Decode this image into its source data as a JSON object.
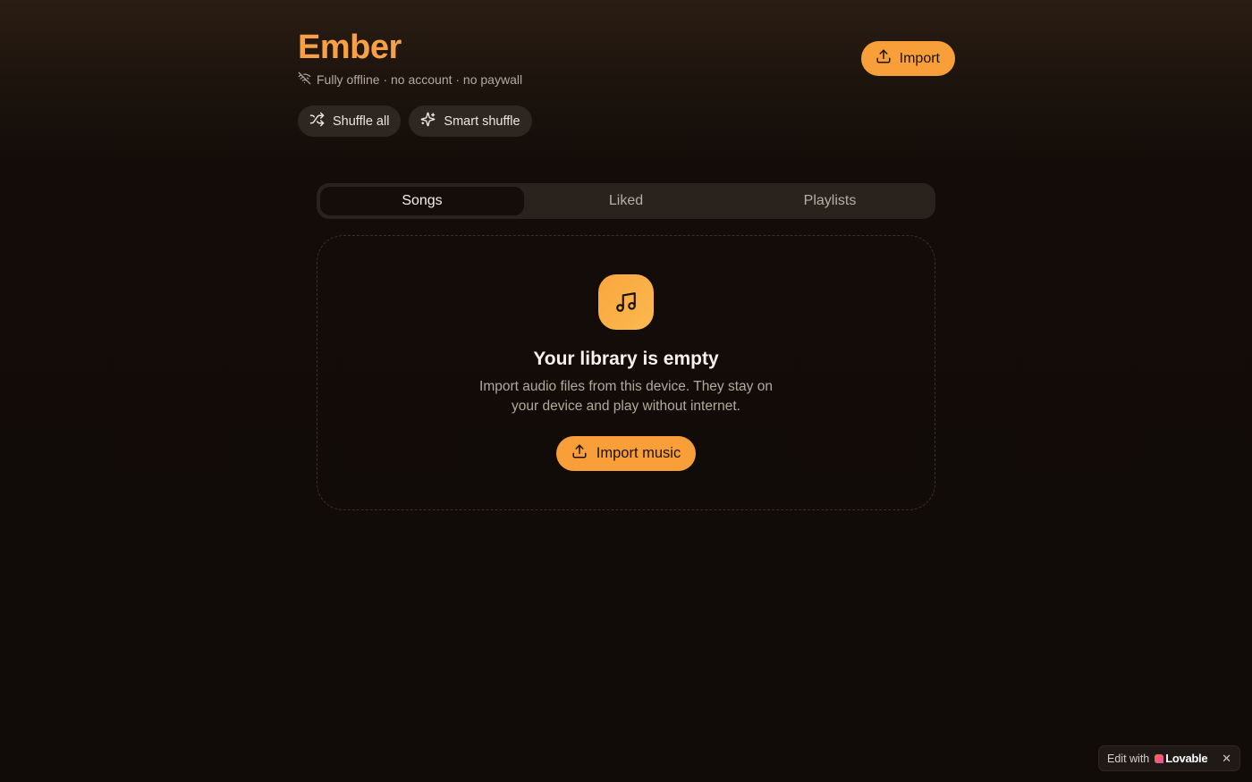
{
  "header": {
    "title": "Ember",
    "subtitle": "Fully offline · no account · no paywall",
    "subtitle_icon": "wifi-off-icon",
    "import_label": "Import",
    "import_icon": "upload-icon"
  },
  "actions": [
    {
      "label": "Shuffle all",
      "icon": "shuffle-icon"
    },
    {
      "label": "Smart shuffle",
      "icon": "sparkles-icon"
    }
  ],
  "tabs": [
    {
      "label": "Songs",
      "active": true
    },
    {
      "label": "Liked",
      "active": false
    },
    {
      "label": "Playlists",
      "active": false
    }
  ],
  "empty_state": {
    "icon": "music-note-icon",
    "title": "Your library is empty",
    "description": "Import audio files from this device. They stay on your device and play without internet.",
    "button_label": "Import music",
    "button_icon": "upload-icon"
  },
  "badge": {
    "prefix": "Edit with",
    "brand": "Lovable",
    "close": "✕"
  },
  "colors": {
    "accent": "#f89f3a",
    "title": "#f7a045",
    "background": "#120c08",
    "surface": "#2a221d"
  }
}
